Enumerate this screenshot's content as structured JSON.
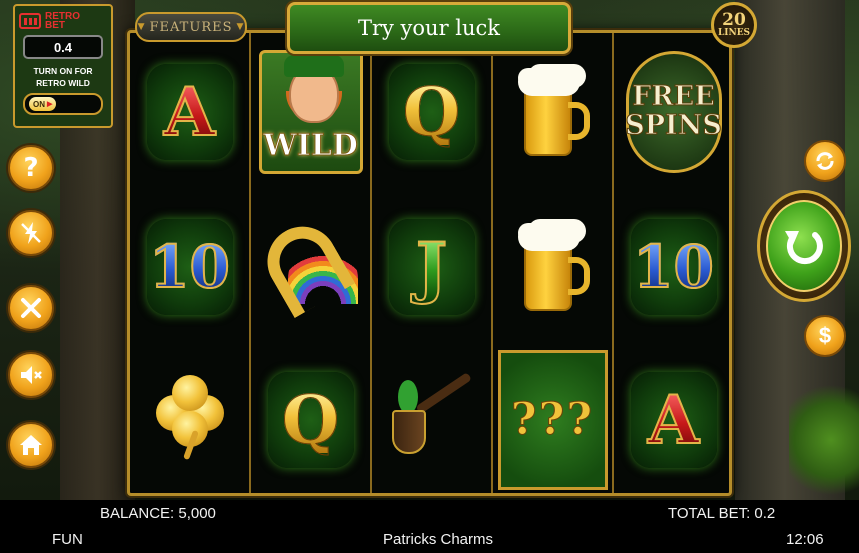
{
  "header": {
    "features_label": "FEATURES",
    "banner_text": "Try your luck",
    "lines_count": "20",
    "lines_label": "LINES"
  },
  "retro_bet": {
    "logo_line1": "RETRO",
    "logo_line2": "BET",
    "value": "0.4",
    "description": "TURN ON FOR RETRO WILD",
    "toggle_label": "ON"
  },
  "left_controls": [
    {
      "name": "help-button",
      "icon": "question-icon",
      "glyph": "?"
    },
    {
      "name": "turbo-button",
      "icon": "lightning-off-icon",
      "glyph": "⚡"
    },
    {
      "name": "settings-button",
      "icon": "tools-icon",
      "glyph": "✕"
    },
    {
      "name": "sound-button",
      "icon": "speaker-muted-icon",
      "glyph": "🔇"
    },
    {
      "name": "home-button",
      "icon": "home-icon",
      "glyph": "⌂"
    }
  ],
  "reels": [
    [
      "A",
      "10",
      "clover"
    ],
    [
      "WILD",
      "horseshoe",
      "Q"
    ],
    [
      "Q",
      "J",
      "pipe"
    ],
    [
      "beer",
      "beer",
      "???"
    ],
    [
      "FREE SPINS",
      "10",
      "A"
    ]
  ],
  "symbols": {
    "wild_text": "WILD",
    "free_line1": "FREE",
    "free_line2": "SPINS",
    "mystery_text": "???"
  },
  "right_controls": {
    "autoplay_icon": "autoplay-icon",
    "spin_icon": "spin-arrow-icon",
    "bet_icon": "dollar-icon",
    "bet_glyph": "$"
  },
  "status_bar": {
    "balance": "BALANCE: 5,000",
    "total_bet": "TOTAL BET: 0.2",
    "mode": "FUN",
    "game_title": "Patricks Charms",
    "clock": "12:06"
  }
}
